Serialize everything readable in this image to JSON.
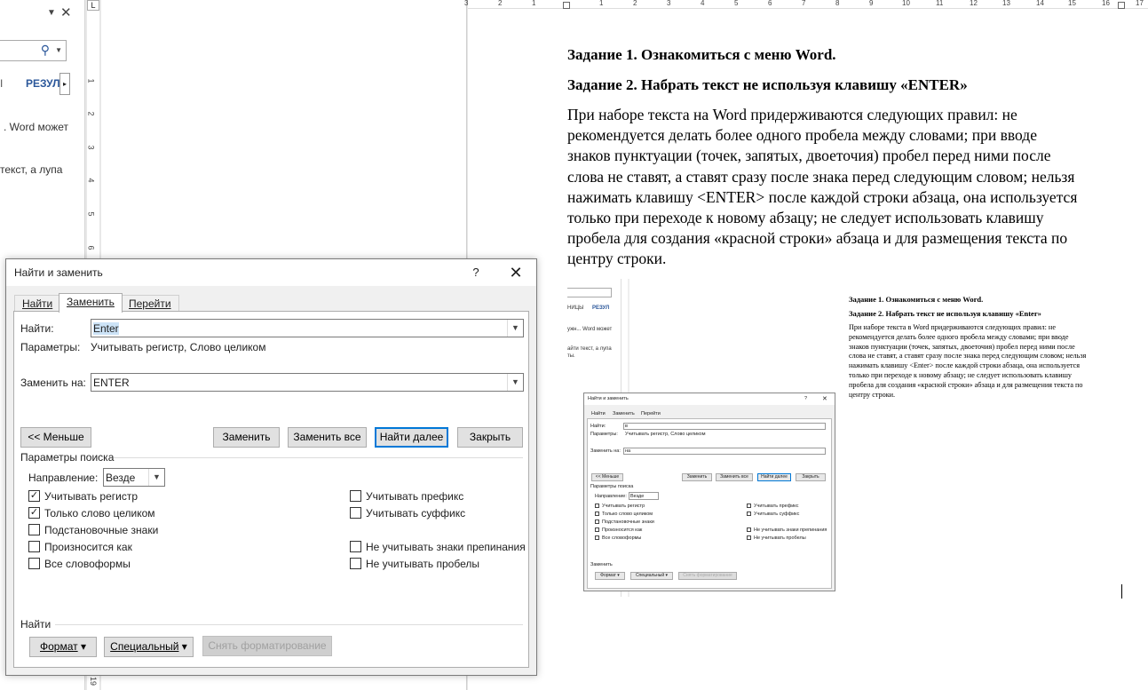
{
  "nav_pane": {
    "search_placeholder": "",
    "tab_partial": "I",
    "tab_results": "РЕЗУЛ",
    "text_line1": ". Word может",
    "text_line2": "текст, а лупа",
    "icons": [
      "search-icon",
      "close-icon",
      "dropdown-icon",
      "chevron-right-icon"
    ]
  },
  "ruler": {
    "corner": "L",
    "vertical_numbers": [
      "1",
      "2",
      "3",
      "4",
      "5",
      "6",
      "19"
    ],
    "horizontal_numbers": [
      "3",
      "2",
      "1",
      "1",
      "2",
      "3",
      "4",
      "5",
      "6",
      "7",
      "8",
      "9",
      "10",
      "11",
      "12",
      "13",
      "14",
      "15",
      "16",
      "17"
    ]
  },
  "document": {
    "heading1": "Задание 1. Ознакомиться с меню Word.",
    "heading2": "Задание 2. Набрать текст не используя клавишу «ENTER»",
    "body_lines": [
      "При наборе текста на Word придерживаются следующих правил: не",
      "рекомендуется делать более одного пробела между словами; при вводе",
      "знаков пунктуации (точек, запятых, двоеточия) пробел перед ними после",
      "слова не ставят, а ставят сразу после знака перед следующим словом; нельзя",
      "нажимать клавишу <ENTER> после каждой строки абзаца, она используется",
      "только при переходе к новому абзацу; не следует использовать клавишу",
      "пробела для создания «красной строки» абзаца и для размещения текста по",
      "центру строки."
    ]
  },
  "embedded_image": {
    "nav_tab_left": "НИЦЫ",
    "nav_tab_results": "РЕЗУЛ",
    "nav_text1": "ужн... Word может",
    "nav_text2": "айти текст, а лупа",
    "nav_text3": "ты.",
    "dialog_title": "Найти и заменить",
    "tabs": [
      "Найти",
      "Заменить",
      "Перейти"
    ],
    "find_label": "Найти:",
    "find_value": "в",
    "params_label": "Параметры:",
    "params_value": "Учитывать регистр, Слово целиком",
    "replace_label": "Заменить на:",
    "replace_value": "на",
    "less_btn": "<< Меньше",
    "replace_btn": "Заменить",
    "replace_all_btn": "Заменить все",
    "find_next_btn": "Найти далее",
    "close_btn": "Закрыть",
    "search_params": "Параметры поиска",
    "direction_label": "Направление:",
    "direction_value": "Везде",
    "options_left": [
      "Учитывать регистр",
      "Только слово целиком",
      "Подстановочные знаки",
      "Произносится как",
      "Все словоформы"
    ],
    "options_right": [
      "Учитывать префикс",
      "Учитывать суффикс",
      "Не учитывать знаки препинания",
      "Не учитывать пробелы"
    ],
    "replace_section": "Заменить",
    "format_btn": "Формат ▾",
    "special_btn": "Специальный ▾",
    "clear_format_btn": "Снять форматирование",
    "doc_heading1": "Задание 1. Ознакомиться с меню Word.",
    "doc_heading2": "Задание 2. Набрать текст не используя клавишу «Enter»",
    "doc_lines": [
      "При наборе текста в Word придерживаются следующих правил: не",
      "рекомендуется делать более одного пробела между словами; при вводе",
      "знаков пунктуации (точек, запятых, двоеточия) пробел перед ними после",
      "слова не ставят, а ставят сразу после знака перед следующим словом; нельзя",
      "нажимать клавишу <Enter> после каждой строки абзаца, она используется",
      "только при переходе к новому абзацу; не следует использовать клавишу",
      "пробела для создания «красной строки» абзаца и для размещения текста по",
      "центру строки."
    ]
  },
  "dialog": {
    "title": "Найти и заменить",
    "help": "?",
    "close": "✕",
    "tabs": {
      "find": "Найти",
      "replace": "Заменить",
      "goto": "Перейти"
    },
    "find_label": "Найти:",
    "find_value": "Enter",
    "params_label": "Параметры:",
    "params_value": "Учитывать регистр, Слово целиком",
    "replace_label": "Заменить на:",
    "replace_value": "ENTER",
    "buttons": {
      "less": "<< Меньше",
      "replace": "Заменить",
      "replace_all": "Заменить все",
      "find_next": "Найти далее",
      "close": "Закрыть"
    },
    "search_params": "Параметры поиска",
    "direction_label": "Направление:",
    "direction_value": "Везде",
    "options": {
      "match_case": {
        "label": "Учитывать регистр",
        "checked": true
      },
      "whole_word": {
        "label": "Только слово целиком",
        "checked": true
      },
      "wildcards": {
        "label": "Подстановочные знаки",
        "checked": false
      },
      "sounds_like": {
        "label": "Произносится как",
        "checked": false
      },
      "all_forms": {
        "label": "Все словоформы",
        "checked": false
      },
      "prefix": {
        "label": "Учитывать префикс",
        "checked": false
      },
      "suffix": {
        "label": "Учитывать суффикс",
        "checked": false
      },
      "ignore_punct": {
        "label": "Не учитывать знаки препинания",
        "checked": false
      },
      "ignore_space": {
        "label": "Не учитывать пробелы",
        "checked": false
      }
    },
    "find_section": "Найти",
    "format_btn": "Формат",
    "special_btn": "Специальный",
    "clear_format_btn": "Снять форматирование"
  },
  "colors": {
    "accent": "#2b579a",
    "focus_border": "#0078d7",
    "selection": "#cce3f7"
  }
}
